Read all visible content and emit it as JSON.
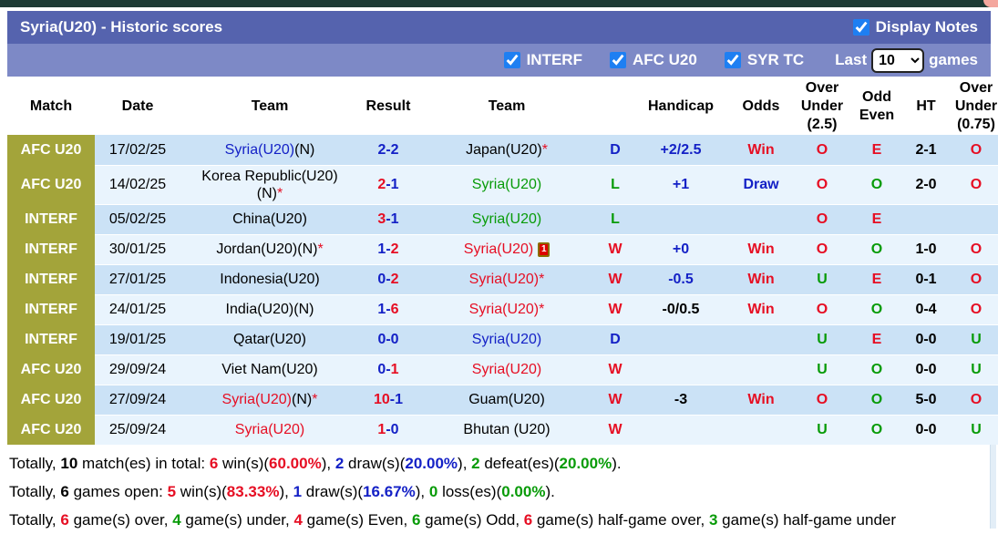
{
  "palette": {
    "blue": "#1421c6",
    "red": "#e60e23",
    "green": "#089b08",
    "black": "#000000",
    "olive": "#a3a43a",
    "title_bar_bg": "#5563ae",
    "filter_bar_bg": "#7d89c6",
    "row_dark": "#cbe2f6",
    "row_light": "#e9f4fd",
    "checkbox_blue": "#1e7ff2"
  },
  "title_bar": {
    "title": "Syria(U20) - Historic scores",
    "display_notes_label": "Display Notes",
    "display_notes_checked": true
  },
  "filter_bar": {
    "checkboxes": [
      {
        "id": "interf",
        "label": "INTERF",
        "checked": true
      },
      {
        "id": "afc-u20",
        "label": "AFC U20",
        "checked": true
      },
      {
        "id": "syr-tc",
        "label": "SYR TC",
        "checked": true
      }
    ],
    "last_label": "Last",
    "games_label": "games",
    "select": {
      "value": "10",
      "options": [
        "10"
      ]
    }
  },
  "table": {
    "columns": [
      {
        "key": "match",
        "label": "Match"
      },
      {
        "key": "date",
        "label": "Date"
      },
      {
        "key": "team1",
        "label": "Team"
      },
      {
        "key": "result",
        "label": "Result"
      },
      {
        "key": "team2",
        "label": "Team"
      },
      {
        "key": "wdl",
        "label": ""
      },
      {
        "key": "handicap",
        "label": "Handicap"
      },
      {
        "key": "odds",
        "label": "Odds"
      },
      {
        "key": "ou25",
        "label": "Over\nUnder\n(2.5)"
      },
      {
        "key": "oddeven",
        "label": "Odd\nEven"
      },
      {
        "key": "ht",
        "label": "HT"
      },
      {
        "key": "ou075",
        "label": "Over\nUnder\n(0.75)"
      }
    ],
    "rows": [
      {
        "match": "AFC U20",
        "date": "17/02/25",
        "team1": [
          {
            "t": "Syria(U20)",
            "c": "blue"
          },
          {
            "t": "(N)"
          }
        ],
        "result": [
          {
            "t": "2-2",
            "c": "blue"
          }
        ],
        "team2": [
          {
            "t": "Japan(U20)"
          },
          {
            "t": "*",
            "c": "red"
          }
        ],
        "wdl": [
          {
            "t": "D",
            "c": "blue"
          }
        ],
        "handicap": [
          {
            "t": "+2/2.5",
            "c": "blue"
          }
        ],
        "odds": [
          {
            "t": "Win",
            "c": "red"
          }
        ],
        "ou25": [
          {
            "t": "O",
            "c": "red"
          }
        ],
        "oddeven": [
          {
            "t": "E",
            "c": "red"
          }
        ],
        "ht": [
          {
            "t": "2-1"
          }
        ],
        "ou075": [
          {
            "t": "O",
            "c": "red"
          }
        ]
      },
      {
        "match": "AFC U20",
        "date": "14/02/25",
        "team1": [
          {
            "t": "Korea Republic(U20)(N)"
          },
          {
            "t": "*",
            "c": "red"
          }
        ],
        "result": [
          {
            "t": "2",
            "c": "red"
          },
          {
            "t": "-1",
            "c": "blue"
          }
        ],
        "team2": [
          {
            "t": "Syria(U20)",
            "c": "green"
          }
        ],
        "wdl": [
          {
            "t": "L",
            "c": "green"
          }
        ],
        "handicap": [
          {
            "t": "+1",
            "c": "blue"
          }
        ],
        "odds": [
          {
            "t": "Draw",
            "c": "blue"
          }
        ],
        "ou25": [
          {
            "t": "O",
            "c": "red"
          }
        ],
        "oddeven": [
          {
            "t": "O",
            "c": "green"
          }
        ],
        "ht": [
          {
            "t": "2-0"
          }
        ],
        "ou075": [
          {
            "t": "O",
            "c": "red"
          }
        ]
      },
      {
        "match": "INTERF",
        "date": "05/02/25",
        "team1": [
          {
            "t": "China(U20)"
          }
        ],
        "result": [
          {
            "t": "3",
            "c": "red"
          },
          {
            "t": "-1",
            "c": "blue"
          }
        ],
        "team2": [
          {
            "t": "Syria(U20)",
            "c": "green"
          }
        ],
        "wdl": [
          {
            "t": "L",
            "c": "green"
          }
        ],
        "handicap": [],
        "odds": [],
        "ou25": [
          {
            "t": "O",
            "c": "red"
          }
        ],
        "oddeven": [
          {
            "t": "E",
            "c": "red"
          }
        ],
        "ht": [],
        "ou075": []
      },
      {
        "match": "INTERF",
        "date": "30/01/25",
        "team1": [
          {
            "t": "Jordan(U20)(N)"
          },
          {
            "t": "*",
            "c": "red"
          }
        ],
        "result": [
          {
            "t": "1-",
            "c": "blue"
          },
          {
            "t": "2",
            "c": "red"
          }
        ],
        "team2": [
          {
            "t": "Syria(U20)",
            "c": "red"
          }
        ],
        "team2_icon": {
          "type": "red-card",
          "label": "1"
        },
        "wdl": [
          {
            "t": "W",
            "c": "red"
          }
        ],
        "handicap": [
          {
            "t": "+0",
            "c": "blue"
          }
        ],
        "odds": [
          {
            "t": "Win",
            "c": "red"
          }
        ],
        "ou25": [
          {
            "t": "O",
            "c": "red"
          }
        ],
        "oddeven": [
          {
            "t": "O",
            "c": "green"
          }
        ],
        "ht": [
          {
            "t": "1-0"
          }
        ],
        "ou075": [
          {
            "t": "O",
            "c": "red"
          }
        ]
      },
      {
        "match": "INTERF",
        "date": "27/01/25",
        "team1": [
          {
            "t": "Indonesia(U20)"
          }
        ],
        "result": [
          {
            "t": "0-",
            "c": "blue"
          },
          {
            "t": "2",
            "c": "red"
          }
        ],
        "team2": [
          {
            "t": "Syria(U20)*",
            "c": "red"
          }
        ],
        "wdl": [
          {
            "t": "W",
            "c": "red"
          }
        ],
        "handicap": [
          {
            "t": "-0.5",
            "c": "blue"
          }
        ],
        "odds": [
          {
            "t": "Win",
            "c": "red"
          }
        ],
        "ou25": [
          {
            "t": "U",
            "c": "green"
          }
        ],
        "oddeven": [
          {
            "t": "E",
            "c": "red"
          }
        ],
        "ht": [
          {
            "t": "0-1"
          }
        ],
        "ou075": [
          {
            "t": "O",
            "c": "red"
          }
        ]
      },
      {
        "match": "INTERF",
        "date": "24/01/25",
        "team1": [
          {
            "t": "India(U20)(N)"
          }
        ],
        "result": [
          {
            "t": "1-",
            "c": "blue"
          },
          {
            "t": "6",
            "c": "red"
          }
        ],
        "team2": [
          {
            "t": "Syria(U20)*",
            "c": "red"
          }
        ],
        "wdl": [
          {
            "t": "W",
            "c": "red"
          }
        ],
        "handicap": [
          {
            "t": "-0/0.5"
          }
        ],
        "odds": [
          {
            "t": "Win",
            "c": "red"
          }
        ],
        "ou25": [
          {
            "t": "O",
            "c": "red"
          }
        ],
        "oddeven": [
          {
            "t": "O",
            "c": "green"
          }
        ],
        "ht": [
          {
            "t": "0-4"
          }
        ],
        "ou075": [
          {
            "t": "O",
            "c": "red"
          }
        ]
      },
      {
        "match": "INTERF",
        "date": "19/01/25",
        "team1": [
          {
            "t": "Qatar(U20)"
          }
        ],
        "result": [
          {
            "t": "0-0",
            "c": "blue"
          }
        ],
        "team2": [
          {
            "t": "Syria(U20)",
            "c": "blue"
          }
        ],
        "wdl": [
          {
            "t": "D",
            "c": "blue"
          }
        ],
        "handicap": [],
        "odds": [],
        "ou25": [
          {
            "t": "U",
            "c": "green"
          }
        ],
        "oddeven": [
          {
            "t": "E",
            "c": "red"
          }
        ],
        "ht": [
          {
            "t": "0-0"
          }
        ],
        "ou075": [
          {
            "t": "U",
            "c": "green"
          }
        ]
      },
      {
        "match": "AFC U20",
        "date": "29/09/24",
        "team1": [
          {
            "t": "Viet Nam(U20)"
          }
        ],
        "result": [
          {
            "t": "0-",
            "c": "blue"
          },
          {
            "t": "1",
            "c": "red"
          }
        ],
        "team2": [
          {
            "t": "Syria(U20)",
            "c": "red"
          }
        ],
        "wdl": [
          {
            "t": "W",
            "c": "red"
          }
        ],
        "handicap": [],
        "odds": [],
        "ou25": [
          {
            "t": "U",
            "c": "green"
          }
        ],
        "oddeven": [
          {
            "t": "O",
            "c": "green"
          }
        ],
        "ht": [
          {
            "t": "0-0"
          }
        ],
        "ou075": [
          {
            "t": "U",
            "c": "green"
          }
        ]
      },
      {
        "match": "AFC U20",
        "date": "27/09/24",
        "team1": [
          {
            "t": "Syria(U20)",
            "c": "red"
          },
          {
            "t": "(N)"
          },
          {
            "t": "*",
            "c": "red"
          }
        ],
        "result": [
          {
            "t": "10",
            "c": "red"
          },
          {
            "t": "-1",
            "c": "blue"
          }
        ],
        "team2": [
          {
            "t": "Guam(U20)"
          }
        ],
        "wdl": [
          {
            "t": "W",
            "c": "red"
          }
        ],
        "handicap": [
          {
            "t": "-3"
          }
        ],
        "odds": [
          {
            "t": "Win",
            "c": "red"
          }
        ],
        "ou25": [
          {
            "t": "O",
            "c": "red"
          }
        ],
        "oddeven": [
          {
            "t": "O",
            "c": "green"
          }
        ],
        "ht": [
          {
            "t": "5-0"
          }
        ],
        "ou075": [
          {
            "t": "O",
            "c": "red"
          }
        ]
      },
      {
        "match": "AFC U20",
        "date": "25/09/24",
        "team1": [
          {
            "t": "Syria(U20)",
            "c": "red"
          }
        ],
        "result": [
          {
            "t": "1",
            "c": "red"
          },
          {
            "t": "-0",
            "c": "blue"
          }
        ],
        "team2": [
          {
            "t": "Bhutan (U20)"
          }
        ],
        "wdl": [
          {
            "t": "W",
            "c": "red"
          }
        ],
        "handicap": [],
        "odds": [],
        "ou25": [
          {
            "t": "U",
            "c": "green"
          }
        ],
        "oddeven": [
          {
            "t": "O",
            "c": "green"
          }
        ],
        "ht": [
          {
            "t": "0-0"
          }
        ],
        "ou075": [
          {
            "t": "U",
            "c": "green"
          }
        ]
      }
    ]
  },
  "summary": {
    "lines": [
      [
        {
          "t": "Totally, "
        },
        {
          "t": "10",
          "b": true
        },
        {
          "t": " match(es) in total: "
        },
        {
          "t": "6",
          "c": "red",
          "b": true
        },
        {
          "t": " win(s)("
        },
        {
          "t": "60.00%",
          "c": "red",
          "b": true
        },
        {
          "t": "), "
        },
        {
          "t": "2",
          "c": "blue",
          "b": true
        },
        {
          "t": " draw(s)("
        },
        {
          "t": "20.00%",
          "c": "blue",
          "b": true
        },
        {
          "t": "), "
        },
        {
          "t": "2",
          "c": "green",
          "b": true
        },
        {
          "t": " defeat(es)("
        },
        {
          "t": "20.00%",
          "c": "green",
          "b": true
        },
        {
          "t": ")."
        }
      ],
      [
        {
          "t": "Totally, "
        },
        {
          "t": "6",
          "b": true
        },
        {
          "t": " games open: "
        },
        {
          "t": "5",
          "c": "red",
          "b": true
        },
        {
          "t": " win(s)("
        },
        {
          "t": "83.33%",
          "c": "red",
          "b": true
        },
        {
          "t": "), "
        },
        {
          "t": "1",
          "c": "blue",
          "b": true
        },
        {
          "t": " draw(s)("
        },
        {
          "t": "16.67%",
          "c": "blue",
          "b": true
        },
        {
          "t": "), "
        },
        {
          "t": "0",
          "c": "green",
          "b": true
        },
        {
          "t": " loss(es)("
        },
        {
          "t": "0.00%",
          "c": "green",
          "b": true
        },
        {
          "t": ")."
        }
      ],
      [
        {
          "t": "Totally, "
        },
        {
          "t": "6",
          "c": "red",
          "b": true
        },
        {
          "t": " game(s) over, "
        },
        {
          "t": "4",
          "c": "green",
          "b": true
        },
        {
          "t": " game(s) under, "
        },
        {
          "t": "4",
          "c": "red",
          "b": true
        },
        {
          "t": " game(s) Even, "
        },
        {
          "t": "6",
          "c": "green",
          "b": true
        },
        {
          "t": " game(s) Odd, "
        },
        {
          "t": "6",
          "c": "red",
          "b": true
        },
        {
          "t": " game(s) half-game over, "
        },
        {
          "t": "3",
          "c": "green",
          "b": true
        },
        {
          "t": " game(s) half-game under"
        }
      ]
    ]
  }
}
